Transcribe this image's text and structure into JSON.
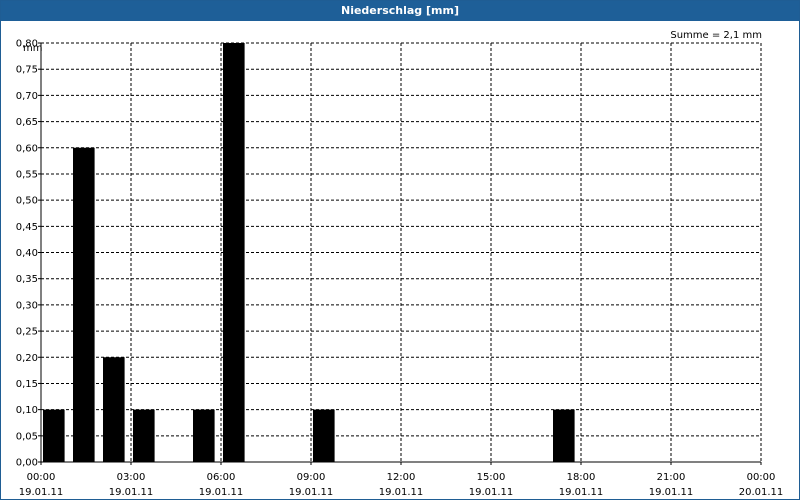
{
  "window": {
    "title": "Niederschlag [mm]"
  },
  "chart_data": {
    "type": "bar",
    "title": "Niederschlag [mm]",
    "ylabel": "mm",
    "sum_label": "Summe = 2,1 mm",
    "ylim": [
      0,
      0.8
    ],
    "y_ticks": [
      "0,00",
      "0,05",
      "0,10",
      "0,15",
      "0,20",
      "0,25",
      "0,30",
      "0,35",
      "0,40",
      "0,45",
      "0,50",
      "0,55",
      "0,60",
      "0,65",
      "0,70",
      "0,75",
      "0,80"
    ],
    "xlim_hours": [
      0,
      24
    ],
    "x_ticks": [
      {
        "hour": 0,
        "time": "00:00",
        "date": "19.01.11"
      },
      {
        "hour": 3,
        "time": "03:00",
        "date": "19.01.11"
      },
      {
        "hour": 6,
        "time": "06:00",
        "date": "19.01.11"
      },
      {
        "hour": 9,
        "time": "09:00",
        "date": "19.01.11"
      },
      {
        "hour": 12,
        "time": "12:00",
        "date": "19.01.11"
      },
      {
        "hour": 15,
        "time": "15:00",
        "date": "19.01.11"
      },
      {
        "hour": 18,
        "time": "18:00",
        "date": "19.01.11"
      },
      {
        "hour": 21,
        "time": "21:00",
        "date": "19.01.11"
      },
      {
        "hour": 24,
        "time": "00:00",
        "date": "20.01.11"
      }
    ],
    "bars": [
      {
        "hour": 0,
        "value": 0.1
      },
      {
        "hour": 1,
        "value": 0.6
      },
      {
        "hour": 2,
        "value": 0.2
      },
      {
        "hour": 3,
        "value": 0.1
      },
      {
        "hour": 5,
        "value": 0.1
      },
      {
        "hour": 6,
        "value": 0.8
      },
      {
        "hour": 9,
        "value": 0.1
      },
      {
        "hour": 17,
        "value": 0.1
      }
    ],
    "grid": true,
    "bar_color": "#000000",
    "titlebar_color": "#1e5f98"
  }
}
